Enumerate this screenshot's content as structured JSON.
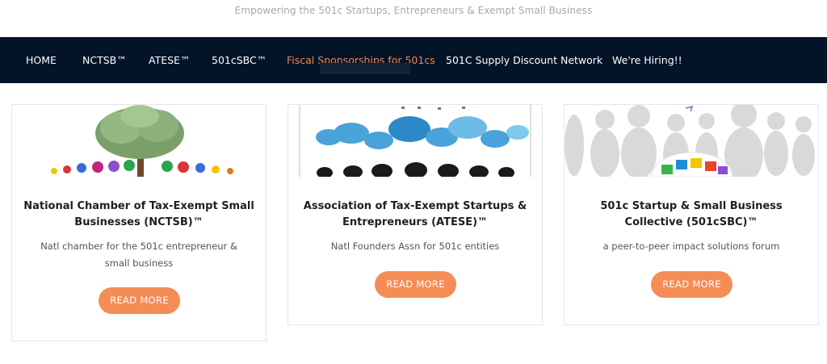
{
  "site": {
    "tagline": "Empowering the 501c Startups, Entrepreneurs & Exempt Small Business"
  },
  "nav": {
    "items": [
      {
        "label": "HOME",
        "active": false
      },
      {
        "label": "NCTSB™",
        "active": false
      },
      {
        "label": "ATESE™",
        "active": false
      },
      {
        "label": "501cSBC™",
        "active": false
      },
      {
        "label": "Fiscal Sponsorships for 501cs",
        "active": true
      },
      {
        "label": "501C Supply Discount Network",
        "active": false
      },
      {
        "label": "We're Hiring!!",
        "active": false
      }
    ],
    "active_color": "#ee8750",
    "background": "#031328"
  },
  "cards": [
    {
      "image_icon": "money-tree-image",
      "title": "National Chamber of Tax-Exempt Small Businesses (NCTSB)™",
      "description": "Natl chamber for the 501c entrepreneur & small business",
      "button_label": "READ MORE"
    },
    {
      "image_icon": "speech-bubbles-image",
      "title": "Association of Tax-Exempt Startups & Entrepreneurs (ATESE)™",
      "description": "Natl Founders Assn for 501c entities",
      "button_label": "READ MORE"
    },
    {
      "image_icon": "figures-puzzle-image",
      "title": "501c Startup & Small Business Collective (501cSBC)™",
      "description": "a peer-to-peer impact solutions forum",
      "button_label": "READ MORE"
    }
  ],
  "colors": {
    "accent": "#f48c56",
    "title": "#1f1f1f",
    "text": "#555555"
  }
}
